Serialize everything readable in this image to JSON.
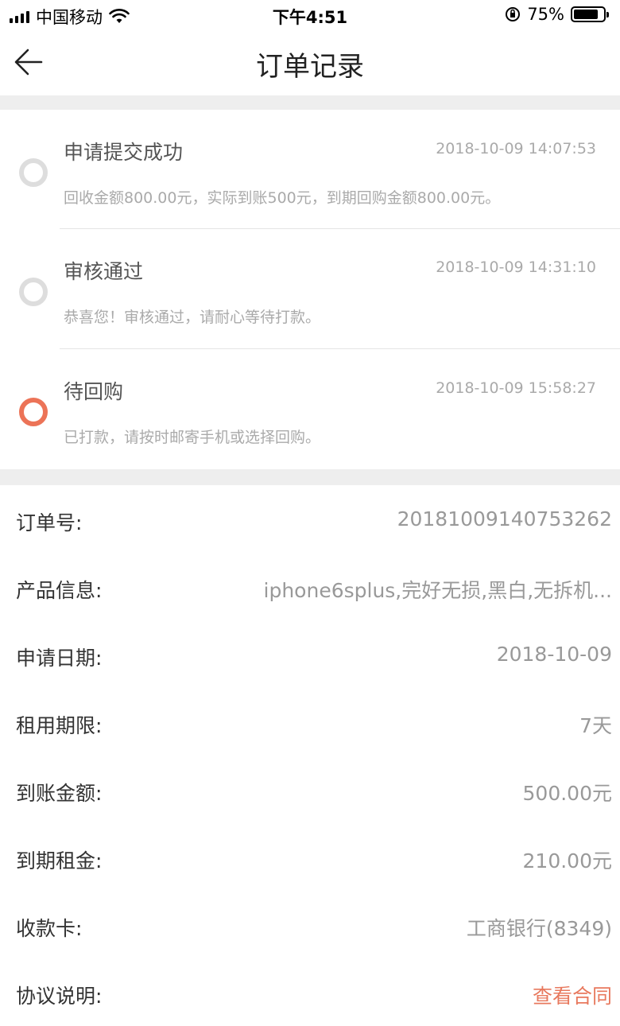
{
  "status_bar": {
    "carrier": "中国移动",
    "time": "下午4:51",
    "battery_percent": "75%",
    "battery_level": 0.75
  },
  "nav": {
    "title": "订单记录",
    "back_icon": "arrow-left-icon"
  },
  "timeline": [
    {
      "label": "申请提交成功",
      "time": "2018-10-09 14:07:53",
      "desc": "回收金额800.00元，实际到账500元，到期回购金额800.00元。",
      "active": false
    },
    {
      "label": "审核通过",
      "time": "2018-10-09 14:31:10",
      "desc": "恭喜您！审核通过，请耐心等待打款。",
      "active": false
    },
    {
      "label": "待回购",
      "time": "2018-10-09 15:58:27",
      "desc": "已打款，请按时邮寄手机或选择回购。",
      "active": true
    }
  ],
  "details": [
    {
      "key": "订单号:",
      "value": "20181009140753262"
    },
    {
      "key": "产品信息:",
      "value": "iphone6splus,完好无损,黑白,无拆机..."
    },
    {
      "key": "申请日期:",
      "value": "2018-10-09"
    },
    {
      "key": "租用期限:",
      "value": "7天"
    },
    {
      "key": "到账金额:",
      "value": "500.00元"
    },
    {
      "key": "到期租金:",
      "value": "210.00元"
    },
    {
      "key": "收款卡:",
      "value": "工商银行(8349)"
    },
    {
      "key": "协议说明:",
      "value": "查看合同"
    }
  ],
  "colors": {
    "accent": "#ec7357",
    "link": "#e8795e",
    "separator_bg": "#eeeeee",
    "muted_text": "#aaaaaa"
  }
}
